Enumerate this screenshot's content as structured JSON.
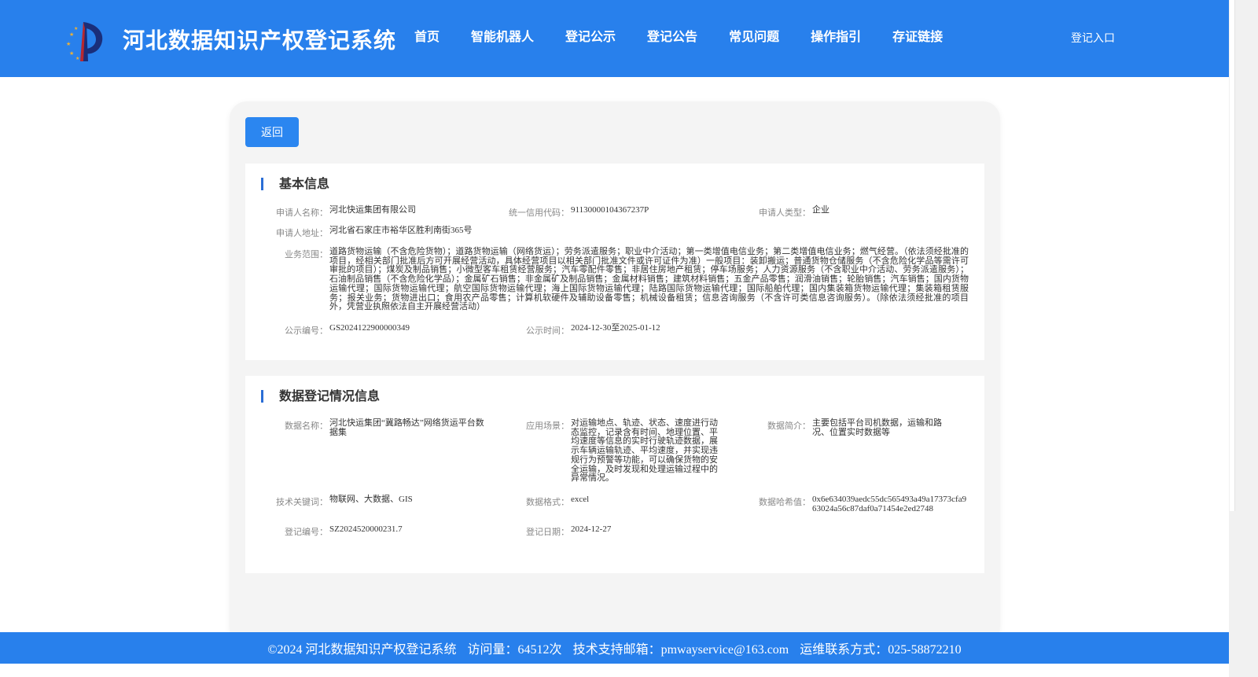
{
  "header": {
    "site_title": "河北数据知识产权登记系统",
    "nav": [
      "首页",
      "智能机器人",
      "登记公示",
      "登记公告",
      "常见问题",
      "操作指引",
      "存证链接"
    ],
    "login": "登记入口"
  },
  "back_button": "返回",
  "basic_info": {
    "title": "基本信息",
    "applicant_name_label": "申请人名称：",
    "applicant_name": "河北快运集团有限公司",
    "credit_code_label": "统一信用代码：",
    "credit_code": "91130000104367237P",
    "applicant_type_label": "申请人类型：",
    "applicant_type": "企业",
    "address_label": "申请人地址：",
    "address": "河北省石家庄市裕华区胜利南街365号",
    "business_scope_label": "业务范围：",
    "business_scope": "道路货物运输（不含危险货物）；道路货物运输（网络货运）；劳务派遣服务；职业中介活动；第一类增值电信业务；第二类增值电信业务；燃气经营。（依法须经批准的项目，经相关部门批准后方可开展经营活动，具体经营项目以相关部门批准文件或许可证件为准）一般项目：装卸搬运；普通货物仓储服务（不含危险化学品等需许可审批的项目）；煤炭及制品销售；小微型客车租赁经营服务；汽车零配件零售；非居住房地产租赁；停车场服务；人力资源服务（不含职业中介活动、劳务派遣服务）；石油制品销售（不含危险化学品）；金属矿石销售；非金属矿及制品销售；金属材料销售；建筑材料销售；五金产品零售；润滑油销售；轮胎销售；汽车销售；国内货物运输代理；国际货物运输代理；航空国际货物运输代理；海上国际货物运输代理；陆路国际货物运输代理；国际船舶代理；国内集装箱货物运输代理；集装箱租赁服务；报关业务；货物进出口；食用农产品零售；计算机软硬件及辅助设备零售；机械设备租赁；信息咨询服务（不含许可类信息咨询服务）。（除依法须经批准的项目外，凭营业执照依法自主开展经营活动）",
    "notice_no_label": "公示编号：",
    "notice_no": "GS2024122900000349",
    "notice_time_label": "公示时间：",
    "notice_time": "2024-12-30至2025-01-12"
  },
  "data_info": {
    "title": "数据登记情况信息",
    "data_name_label": "数据名称：",
    "data_name": "河北快运集团“冀路畅达”网络货运平台数据集",
    "scenario_label": "应用场景：",
    "scenario": "对运输地点、轨迹、状态、速度进行动态监控，记录含有时间、地理位置、平均速度等信息的实时行驶轨迹数据，展示车辆运输轨迹、平均速度，并实现违规行为预警等功能，可以确保货物的安全运输，及时发现和处理运输过程中的异常情况。",
    "intro_label": "数据简介：",
    "intro": "主要包括平台司机数据，运输和路况、位置实时数据等",
    "keywords_label": "技术关键词：",
    "keywords": "物联网、大数据、GIS",
    "format_label": "数据格式：",
    "format": "excel",
    "hash_label": "数据哈希值：",
    "hash": "0x6e634039aedc55dc565493a49a17373cfa963024a56c87daf0a71454e2ed2748",
    "reg_no_label": "登记编号：",
    "reg_no": "SZ2024520000231.7",
    "reg_date_label": "登记日期：",
    "reg_date": "2024-12-27"
  },
  "footer": {
    "copyright": "©2024 河北数据知识产权登记系统",
    "visits": "访问量：64512次",
    "email": "技术支持邮箱：pmwayservice@163.com",
    "phone": "运维联系方式：025-58872210"
  },
  "colors": {
    "header_bg": "#2880ec",
    "button_bg": "#2b86f0",
    "title_accent": "#2b6ed6",
    "panel_bg": "#f4f4f4"
  },
  "icons": {
    "logo": "logo-icon"
  }
}
